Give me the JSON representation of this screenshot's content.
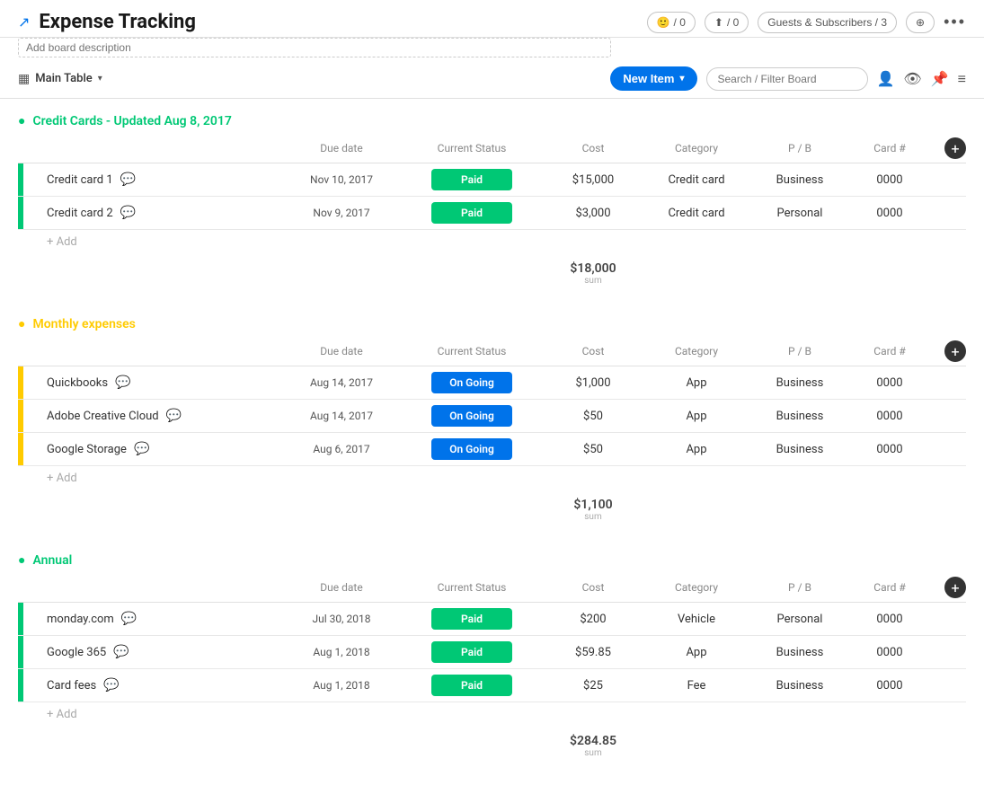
{
  "header": {
    "title": "Expense Tracking",
    "board_desc_placeholder": "Add board description",
    "reactions_count": "/ 0",
    "views_count": "/ 0",
    "guests_label": "Guests & Subscribers / 3",
    "more_icon": "•••"
  },
  "toolbar": {
    "table_label": "Main Table",
    "new_item_label": "New Item",
    "search_placeholder": "Search / Filter Board"
  },
  "groups": [
    {
      "id": "credit-cards",
      "title": "Credit Cards - Updated Aug 8, 2017",
      "color": "#00c875",
      "color_type": "green",
      "columns": [
        "Due date",
        "Current Status",
        "Cost",
        "Category",
        "P / B",
        "Card #"
      ],
      "rows": [
        {
          "name": "Credit card 1",
          "due_date": "Nov 10, 2017",
          "status": "Paid",
          "status_type": "paid",
          "cost": "$15,000",
          "category": "Credit card",
          "pb": "Business",
          "card": "0000"
        },
        {
          "name": "Credit card 2",
          "due_date": "Nov 9, 2017",
          "status": "Paid",
          "status_type": "paid",
          "cost": "$3,000",
          "category": "Credit card",
          "pb": "Personal",
          "card": "0000"
        }
      ],
      "add_label": "+ Add",
      "sum_value": "$18,000",
      "sum_label": "sum"
    },
    {
      "id": "monthly",
      "title": "Monthly expenses",
      "color": "#ffcb00",
      "color_type": "yellow",
      "columns": [
        "Due date",
        "Current Status",
        "Cost",
        "Category",
        "P / B",
        "Card #"
      ],
      "rows": [
        {
          "name": "Quickbooks",
          "due_date": "Aug 14, 2017",
          "status": "On Going",
          "status_type": "ongoing",
          "cost": "$1,000",
          "category": "App",
          "pb": "Business",
          "card": "0000"
        },
        {
          "name": "Adobe Creative Cloud",
          "due_date": "Aug 14, 2017",
          "status": "On Going",
          "status_type": "ongoing",
          "cost": "$50",
          "category": "App",
          "pb": "Business",
          "card": "0000"
        },
        {
          "name": "Google Storage",
          "due_date": "Aug 6, 2017",
          "status": "On Going",
          "status_type": "ongoing",
          "cost": "$50",
          "category": "App",
          "pb": "Business",
          "card": "0000"
        }
      ],
      "add_label": "+ Add",
      "sum_value": "$1,100",
      "sum_label": "sum"
    },
    {
      "id": "annual",
      "title": "Annual",
      "color": "#00c875",
      "color_type": "green",
      "columns": [
        "Due date",
        "Current Status",
        "Cost",
        "Category",
        "P / B",
        "Card #"
      ],
      "rows": [
        {
          "name": "monday.com",
          "due_date": "Jul 30, 2018",
          "status": "Paid",
          "status_type": "paid",
          "cost": "$200",
          "category": "Vehicle",
          "pb": "Personal",
          "card": "0000"
        },
        {
          "name": "Google 365",
          "due_date": "Aug 1, 2018",
          "status": "Paid",
          "status_type": "paid",
          "cost": "$59.85",
          "category": "App",
          "pb": "Business",
          "card": "0000"
        },
        {
          "name": "Card fees",
          "due_date": "Aug 1, 2018",
          "status": "Paid",
          "status_type": "paid",
          "cost": "$25",
          "category": "Fee",
          "pb": "Business",
          "card": "0000"
        }
      ],
      "add_label": "+ Add",
      "sum_value": "$284.85",
      "sum_label": "sum"
    }
  ]
}
